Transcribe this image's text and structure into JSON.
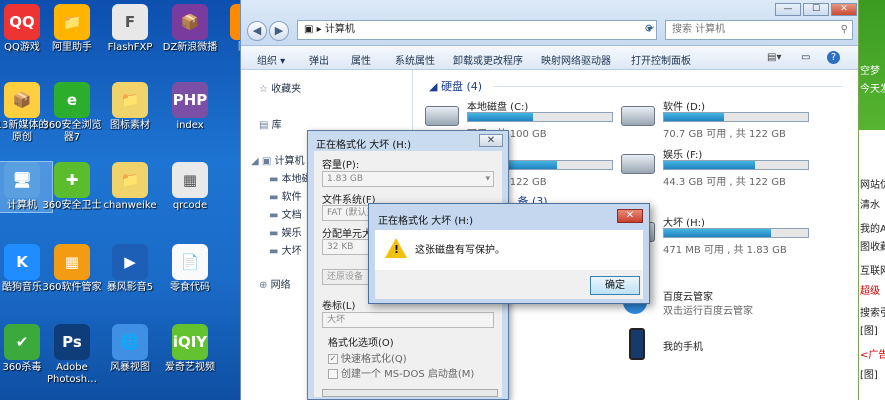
{
  "desktop": {
    "icons": [
      {
        "label": "QQ游戏",
        "color": "#e33"
      },
      {
        "label": "阿里助手",
        "color": "#ffb400"
      },
      {
        "label": "FlashFXP",
        "color": "#e8e8e8"
      },
      {
        "label": "DZ新浪微播",
        "color": "#7a3b9f"
      },
      {
        "label": "阿里",
        "color": "#ff8a00"
      },
      {
        "label": "13新媒体的原创",
        "color": "#ffcf3f"
      },
      {
        "label": "360安全浏览器7",
        "color": "#2cae2c"
      },
      {
        "label": "图标素材",
        "color": "#f0d36a"
      },
      {
        "label": "index",
        "color": "#7b4fa6"
      },
      {
        "label": "计算机",
        "color": "#5aa0e0"
      },
      {
        "label": "360安全卫士",
        "color": "#5bbc2d"
      },
      {
        "label": "chanweike",
        "color": "#f0d36a"
      },
      {
        "label": "qrcode",
        "color": "#e9e9e9"
      },
      {
        "label": "酷狗音乐",
        "color": "#1f8cff"
      },
      {
        "label": "360软件管家",
        "color": "#f29b13"
      },
      {
        "label": "暴风影音5",
        "color": "#1d5fb6"
      },
      {
        "label": "零食代码",
        "color": "#fafafa"
      },
      {
        "label": "360杀毒",
        "color": "#3ca93c"
      },
      {
        "label": "Adobe Photosh…",
        "color": "#0e3d7a"
      },
      {
        "label": "风暴视图",
        "color": "#3f90e4"
      },
      {
        "label": "爱奇艺视频",
        "color": "#62c22f"
      }
    ],
    "glyphs": [
      "QQ",
      "📁",
      "F",
      "📦",
      "📄",
      "📦",
      "e",
      "📁",
      "PHP",
      "🖥",
      "✚",
      "📁",
      "▦",
      "K",
      "▦",
      "▶",
      "📄",
      "✔",
      "Ps",
      "🌐",
      "iQIY"
    ]
  },
  "explorer": {
    "address": "计算机",
    "search_placeholder": "搜索 计算机",
    "toolbar": [
      "组织 ▾",
      "弹出",
      "属性",
      "系统属性",
      "卸载或更改程序",
      "映射网络驱动器",
      "打开控制面板"
    ],
    "nav": [
      "收藏夹",
      "库",
      "计算机",
      "本地磁盘",
      "软件",
      "文档",
      "娱乐",
      "大坏",
      "网络"
    ],
    "groups": {
      "hdd": "硬盘 (4)",
      "removable": "… 备 (3)"
    },
    "drives": [
      {
        "name": "本地磁盘 (C:)",
        "size": "可用 , 共 100 GB",
        "used": 0.45
      },
      {
        "name": "软件 (D:)",
        "size": "70.7 GB 可用 , 共 122 GB",
        "used": 0.42
      },
      {
        "name": "娱乐 (E:)",
        "size": "可用 , 共 122 GB",
        "used": 0.62
      },
      {
        "name": "娱乐 (F:)",
        "size": "44.3 GB 可用 , 共 122 GB",
        "used": 0.63
      },
      {
        "name": "大坏 (H:)",
        "size": "471 MB 可用 , 共 1.83 GB",
        "used": 0.74
      }
    ],
    "others": [
      {
        "name": "百度云管家",
        "sub": "双击运行百度云管家"
      },
      {
        "name": "我的手机",
        "sub": ""
      }
    ]
  },
  "format_dialog": {
    "title": "正在格式化 大坏 (H:)",
    "capacity_label": "容量(P):",
    "capacity": "1.83 GB",
    "fs_label": "文件系统(F)",
    "fs": "FAT (默认)",
    "unit_label": "分配单元大小(A)",
    "unit": "32 KB",
    "restore": "还原设备",
    "volume_label": "卷标(L)",
    "volume": "大坏",
    "options_label": "格式化选项(O)",
    "quick": "快速格式化(Q)",
    "msdos": "创建一个 MS-DOS 启动盘(M)"
  },
  "error_dialog": {
    "title": "正在格式化 大坏 (H:)",
    "message": "这张磁盘有写保护。",
    "ok": "确定"
  },
  "side_panel": [
    "空梦",
    "今天发",
    "网站仿",
    "清水",
    "我的A",
    "图收藏",
    "互联网",
    "超级",
    "搜索引",
    "[图]",
    "<广告",
    "[图]"
  ]
}
